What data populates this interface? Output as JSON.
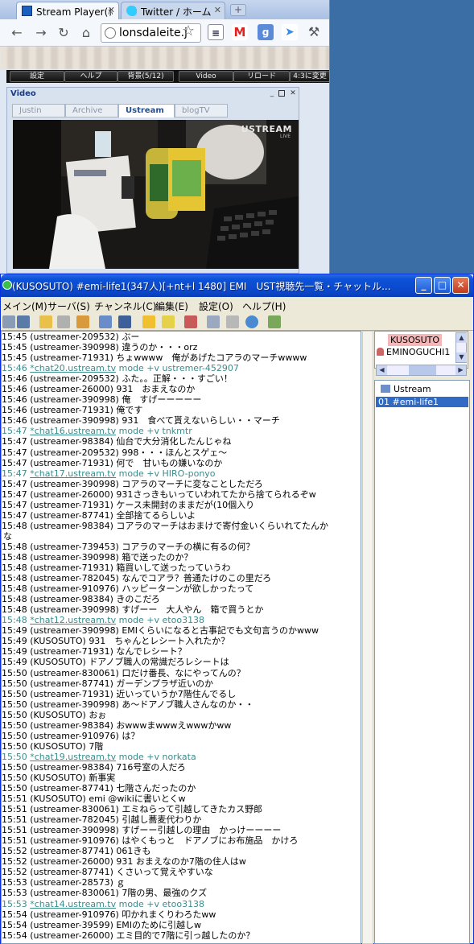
{
  "browser": {
    "tabs": [
      {
        "label": "Stream Player(ﾎ",
        "active": true
      },
      {
        "label": "Twitter / ホーム",
        "active": false
      }
    ],
    "address": "lonsdaleite.j",
    "player_menu": [
      "設定",
      "ヘルプ",
      "背景(5/12)",
      "Video",
      "リロード",
      "4:3に変更"
    ],
    "video_panel": {
      "title": "Video",
      "tabs": [
        "Justin",
        "Archive",
        "Ustream",
        "blogTV"
      ],
      "active_tab": "Ustream",
      "logo": "USTREAM",
      "live": "LIVE"
    }
  },
  "chat": {
    "window_title": "(KUSOSUTO) #emi-life1(347人)[+nt+l 1480] EMI　UST視聴先一覧・チャットル...",
    "menus": [
      "メイン(M)",
      "サーバ(S)",
      "チャンネル(C)",
      "編集(E)",
      "設定(O)",
      "ヘルプ(H)"
    ],
    "nicklist": [
      "KUSOSUTO",
      "EMINOGUCHI1"
    ],
    "channel_tree": {
      "server": "Ustream",
      "channel": "01 #emi-life1"
    },
    "lines": [
      {
        "time": "15:45",
        "nick": "(ustreamer-209532)",
        "text": "ぶー"
      },
      {
        "time": "15:45",
        "nick": "(ustreamer-390998)",
        "text": "違うのか・・・orz"
      },
      {
        "time": "15:45",
        "nick": "(ustreamer-71931)",
        "text": "ちょwwww　俺があげたコアラのマーチwwww",
        "underline": true
      },
      {
        "time": "15:46",
        "nick": "*chat20.ustream.tv",
        "text": "mode +v ustremer-452907",
        "system": true
      },
      {
        "time": "15:46",
        "nick": "(ustreamer-209532)",
        "text": "ふた。。正解・・・すごい！"
      },
      {
        "time": "15:46",
        "nick": "(ustreamer-26000)",
        "text": "931　おまえなのか"
      },
      {
        "time": "15:46",
        "nick": "(ustreamer-390998)",
        "text": "俺　すげーーーーー"
      },
      {
        "time": "15:46",
        "nick": "(ustreamer-71931)",
        "text": "俺です"
      },
      {
        "time": "15:46",
        "nick": "(ustreamer-390998)",
        "text": "931　食べて貰えないらしい・・マーチ"
      },
      {
        "time": "15:47",
        "nick": "*chat16.ustream.tv",
        "text": "mode +v tnkmtr",
        "system": true
      },
      {
        "time": "15:47",
        "nick": "(ustreamer-98384)",
        "text": "仙台で大分消化したんじゃね"
      },
      {
        "time": "15:47",
        "nick": "(ustreamer-209532)",
        "text": "998・・・ほんとスゲェ～"
      },
      {
        "time": "15:47",
        "nick": "(ustreamer-71931)",
        "text": "何で　甘いもの嫌いなのか"
      },
      {
        "time": "15:47",
        "nick": "*chat17.ustream.tv",
        "text": "mode +v HIRO-ponyo",
        "system": true
      },
      {
        "time": "15:47",
        "nick": "(ustreamer-390998)",
        "text": "コアラのマーチに変なことしただろ"
      },
      {
        "time": "15:47",
        "nick": "(ustreamer-26000)",
        "text": "931さっきもいっていわれてたから捨てられるぞw"
      },
      {
        "time": "15:47",
        "nick": "(ustreamer-71931)",
        "text": "ケース未開封のままだが(10個入り",
        "underline": true
      },
      {
        "time": "15:47",
        "nick": "(ustreamer-87741)",
        "text": "全部捨てるらしいよ"
      },
      {
        "time": "15:48",
        "nick": "(ustreamer-98384)",
        "text": "コアラのマーチはおまけで寄付金いくらいれてたんか"
      },
      {
        "continuation": true,
        "text": "な"
      },
      {
        "time": "15:48",
        "nick": "(ustreamer-739453)",
        "text": "コアラのマーチの横に有るの何？"
      },
      {
        "time": "15:48",
        "nick": "(ustreamer-390998)",
        "text": "箱で送ったのか？"
      },
      {
        "time": "15:48",
        "nick": "(ustreamer-71931)",
        "text": "箱買いして送ったっていうわ"
      },
      {
        "time": "15:48",
        "nick": "(ustreamer-782045)",
        "text": "なんでコアラ？普通たけのこの里だろ"
      },
      {
        "time": "15:48",
        "nick": "(ustreamer-910976)",
        "text": "ハッピーターンが欲しかったって"
      },
      {
        "time": "15:48",
        "nick": "(ustreamer-98384)",
        "text": "きのこだろ"
      },
      {
        "time": "15:48",
        "nick": "(ustreamer-390998)",
        "text": "すげーー　大人やん　箱で買うとか"
      },
      {
        "time": "15:48",
        "nick": "*chat12.ustream.tv",
        "text": "mode +v etoo3138",
        "system": true
      },
      {
        "time": "15:49",
        "nick": "(ustreamer-390998)",
        "text": "EMIくらいになると古事記でも文句言うのかwww"
      },
      {
        "time": "15:49",
        "nick": "(KUSOSUTO)",
        "text": "931　ちゃんとレシート入れたか？"
      },
      {
        "time": "15:49",
        "nick": "(ustreamer-71931)",
        "text": "なんでレシート？"
      },
      {
        "time": "15:49",
        "nick": "(KUSOSUTO)",
        "text": "ドアノブ職人の常識だろレシートは"
      },
      {
        "time": "15:50",
        "nick": "(ustreamer-830061)",
        "text": "口だけ番長、なにやってんの？"
      },
      {
        "time": "15:50",
        "nick": "(ustreamer-87741)",
        "text": "ガーデンプラザ近いのか"
      },
      {
        "time": "15:50",
        "nick": "(ustreamer-71931)",
        "text": "近いっていうか7階住んでるし",
        "underline": true
      },
      {
        "time": "15:50",
        "nick": "(ustreamer-390998)",
        "text": "あ～ドアノブ職人さんなのか・・"
      },
      {
        "time": "15:50",
        "nick": "(KUSOSUTO)",
        "text": "おぉ"
      },
      {
        "time": "15:50",
        "nick": "(ustreamer-98384)",
        "text": "おwwwまwwwえwwwかww"
      },
      {
        "time": "15:50",
        "nick": "(ustreamer-910976)",
        "text": "は？"
      },
      {
        "time": "15:50",
        "nick": "(KUSOSUTO)",
        "text": "7階"
      },
      {
        "time": "15:50",
        "nick": "*chat19.ustream.tv",
        "text": "mode +v norkata",
        "system": true
      },
      {
        "time": "15:50",
        "nick": "(ustreamer-98384)",
        "text": "716号室の人だろ"
      },
      {
        "time": "15:50",
        "nick": "(KUSOSUTO)",
        "text": "新事実"
      },
      {
        "time": "15:50",
        "nick": "(ustreamer-87741)",
        "text": "七階さんだったのか"
      },
      {
        "time": "15:51",
        "nick": "(KUSOSUTO)",
        "text": "emi @wikiに書いとくw"
      },
      {
        "time": "15:51",
        "nick": "(ustreamer-830061)",
        "text": "エミねらって引越してきたカス野郎"
      },
      {
        "time": "15:51",
        "nick": "(ustreamer-782045)",
        "text": "引越し蕎麦代わりか"
      },
      {
        "time": "15:51",
        "nick": "(ustreamer-390998)",
        "text": "すげーー引越しの理由　かっけーーーー"
      },
      {
        "time": "15:51",
        "nick": "(ustreamer-910976)",
        "text": "はやくもっと　ドアノブにお布施品　かけろ"
      },
      {
        "time": "15:52",
        "nick": "(ustreamer-87741)",
        "text": "061きも"
      },
      {
        "time": "15:52",
        "nick": "(ustreamer-26000)",
        "text": "931 おまえなのか7階の住人はw"
      },
      {
        "time": "15:52",
        "nick": "(ustreamer-87741)",
        "text": "くさいって覚えやすいな"
      },
      {
        "time": "15:53",
        "nick": "(ustreamer-28573)",
        "text": "ｇ"
      },
      {
        "time": "15:53",
        "nick": "(ustreamer-830061)",
        "text": "7階の男、最強のクズ"
      },
      {
        "time": "15:53",
        "nick": "*chat14.ustream.tv",
        "text": "mode +v etoo3138",
        "system": true
      },
      {
        "time": "15:54",
        "nick": "(ustreamer-910976)",
        "text": "叩かれまくりわろたww"
      },
      {
        "time": "15:54",
        "nick": "(ustreamer-39599)",
        "text": "EMIのために引越しw"
      },
      {
        "time": "15:54",
        "nick": "(ustreamer-26000)",
        "text": "エミ目的で7階に引っ越したのか？"
      }
    ]
  },
  "colors": {
    "title_bar": "#0b46c8",
    "underline": "#e01818",
    "system_text": "#3c8c8c",
    "selected": "#316ac5",
    "op_highlight": "#f4b6b6"
  }
}
